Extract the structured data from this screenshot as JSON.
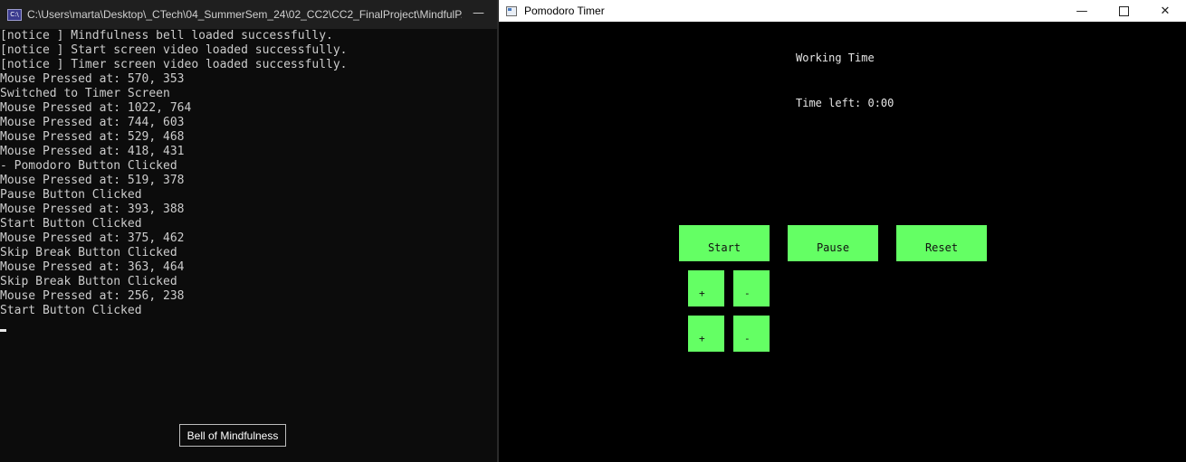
{
  "console": {
    "title": "C:\\Users\\marta\\Desktop\\_CTech\\04_SummerSem_24\\02_CC2\\CC2_FinalProject\\MindfulP...",
    "icon": "cmd-icon",
    "minimize_glyph": "—",
    "lines": [
      "[notice ] Mindfulness bell loaded successfully.",
      "[notice ] Start screen video loaded successfully.",
      "[notice ] Timer screen video loaded successfully.",
      "Mouse Pressed at: 570, 353",
      "Switched to Timer Screen",
      "Mouse Pressed at: 1022, 764",
      "Mouse Pressed at: 744, 603",
      "Mouse Pressed at: 529, 468",
      "Mouse Pressed at: 418, 431",
      "- Pomodoro Button Clicked",
      "Mouse Pressed at: 519, 378",
      "Pause Button Clicked",
      "Mouse Pressed at: 393, 388",
      "Start Button Clicked",
      "Mouse Pressed at: 375, 462",
      "Skip Break Button Clicked",
      "Mouse Pressed at: 363, 464",
      "Skip Break Button Clicked",
      "Mouse Pressed at: 256, 238",
      "Start Button Clicked"
    ],
    "bell_button_label": "Bell of Mindfulness"
  },
  "pomodoro": {
    "title": "Pomodoro Timer",
    "working_label": "Working Time",
    "time_left_label": "Time left: 0:00",
    "buttons": {
      "start": "Start",
      "pause": "Pause",
      "reset": "Reset",
      "plus_1": "+",
      "minus_1": "-",
      "plus_2": "+",
      "minus_2": "-"
    },
    "button_color": "#64ff64",
    "window_controls": {
      "minimize": "—",
      "close": "✕"
    }
  }
}
